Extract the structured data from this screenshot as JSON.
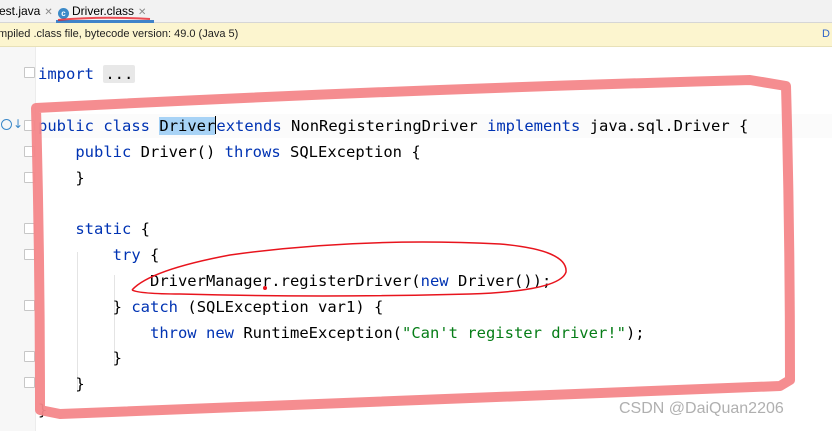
{
  "tabs": [
    {
      "label": "est.java",
      "close": "✕",
      "active": false
    },
    {
      "label": "Driver.class",
      "close": "✕",
      "active": true,
      "icon": "class-icon"
    }
  ],
  "banner": {
    "text": "mpiled .class file, bytecode version: 49.0 (Java 5)",
    "action": "D"
  },
  "code": {
    "l1": {
      "kw": "import",
      "fold": "..."
    },
    "l2": {
      "kw1": "public",
      "kw2": "class",
      "name": "Driver",
      "kw3": "extends",
      "parent": "NonRegisteringDriver",
      "kw4": "implements",
      "iface": "java.sql.Driver {"
    },
    "l3": {
      "kw1": "public",
      "ctor": "Driver()",
      "kw2": "throws",
      "rest": "SQLException {"
    },
    "l4": {
      "text": "}"
    },
    "l5": {
      "kw": "static",
      "rest": "{"
    },
    "l6": {
      "kw": "try",
      "rest": "{"
    },
    "l7": {
      "pre": "DriverManager.registerDriver(",
      "kw": "new",
      "post": "Driver());"
    },
    "l8": {
      "pre": "}",
      "kw": "catch",
      "post": "(SQLException var1) {"
    },
    "l9": {
      "kw1": "throw",
      "kw2": "new",
      "mid": "RuntimeException(",
      "str": "\"Can't register driver!\"",
      "post": ");"
    },
    "l10": {
      "text": "}"
    },
    "l11": {
      "text": "}"
    },
    "l12": {
      "text": "}"
    }
  },
  "watermark": "CSDN @DaiQuan2206",
  "colors": {
    "keyword": "#0033b3",
    "string": "#067d17",
    "selection": "#a8d3f6",
    "annotation_red": "#e8141d",
    "annotation_box": "#f4878a",
    "banner": "#fcf5cf",
    "tab_underline": "#4083c9"
  }
}
